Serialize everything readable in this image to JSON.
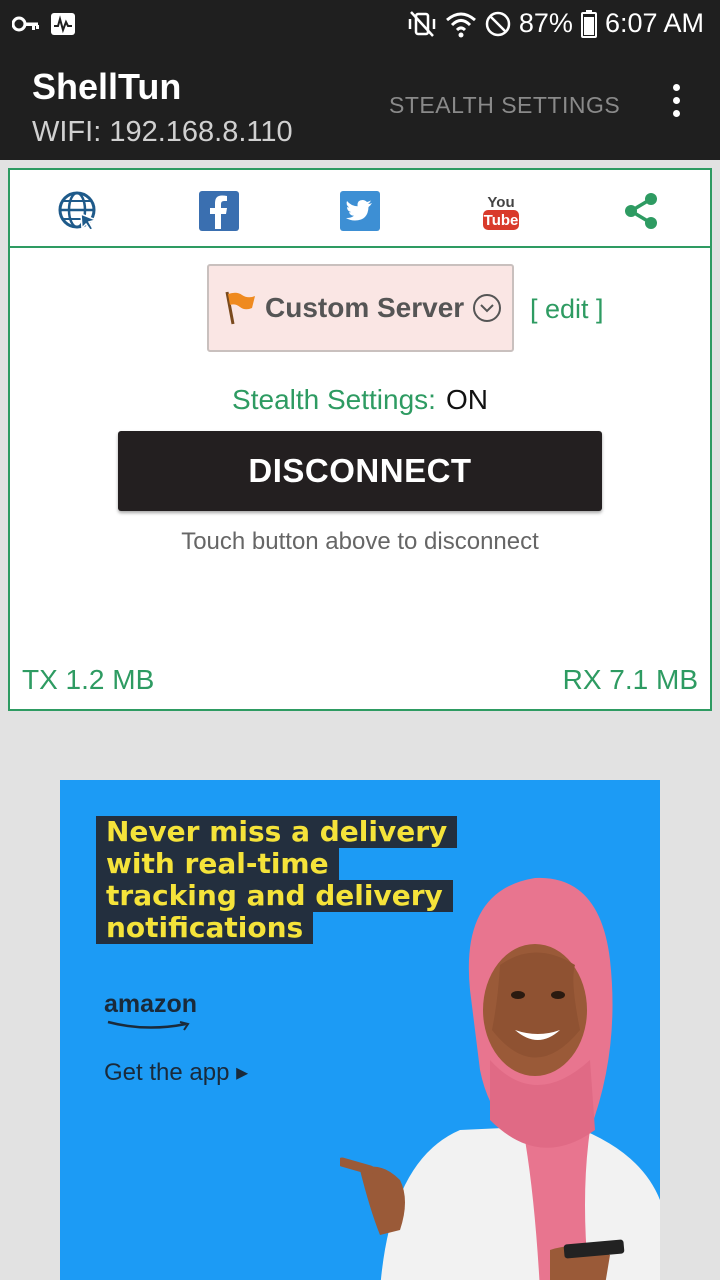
{
  "statusbar": {
    "battery": "87%",
    "time": "6:07 AM"
  },
  "appbar": {
    "title": "ShellTun",
    "subtitle": "WIFI: 192.168.8.110",
    "stealth_settings": "STEALTH SETTINGS"
  },
  "social": {
    "icons": [
      "globe-icon",
      "facebook-icon",
      "twitter-icon",
      "youtube-icon",
      "share-icon"
    ],
    "youtube_text_top": "You",
    "youtube_text_bottom": "Tube"
  },
  "server": {
    "selected": "Custom Server",
    "edit_label": "[ edit ]"
  },
  "stealth": {
    "label": "Stealth Settings:",
    "value": "ON"
  },
  "connection": {
    "button_label": "DISCONNECT",
    "hint": "Touch button above to disconnect",
    "tx": "TX 1.2 MB",
    "rx": "RX 7.1 MB"
  },
  "ad": {
    "headline": [
      "Never miss a delivery",
      "with real-time",
      "tracking and delivery",
      "notifications"
    ],
    "brand": "amazon",
    "cta": "Get the app ▸"
  },
  "colors": {
    "accent": "#2e9b62",
    "appbar": "#1f1f1f",
    "button": "#231f20",
    "ad_bg": "#1c9bf5"
  }
}
